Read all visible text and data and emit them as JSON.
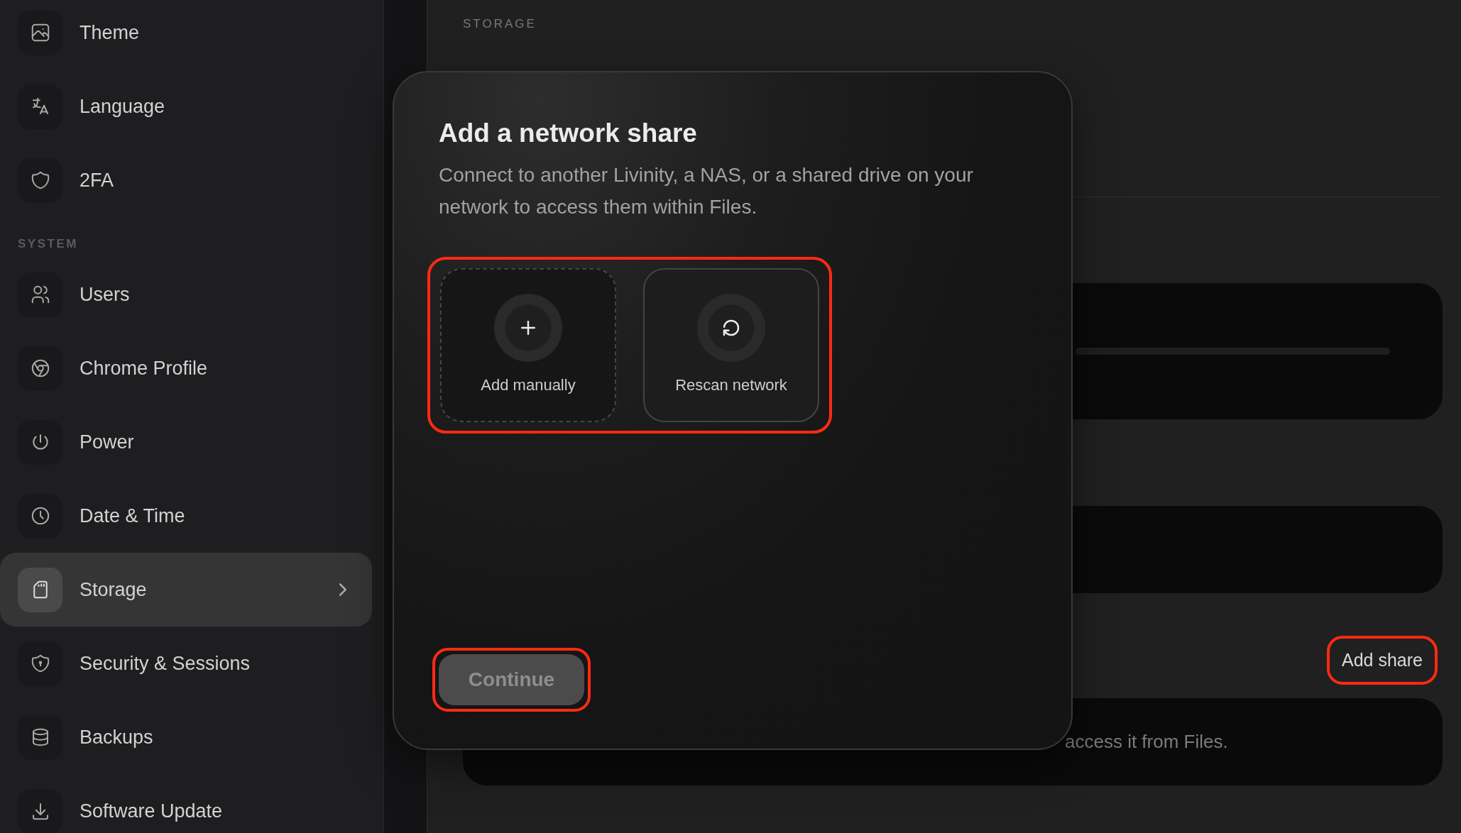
{
  "sidebar": {
    "sections": [
      {
        "items": [
          {
            "label": "Theme",
            "selected": false
          },
          {
            "label": "Language",
            "selected": false
          },
          {
            "label": "2FA",
            "selected": false
          }
        ]
      },
      {
        "title": "SYSTEM",
        "items": [
          {
            "label": "Users",
            "selected": false
          },
          {
            "label": "Chrome Profile",
            "selected": false
          },
          {
            "label": "Power",
            "selected": false
          },
          {
            "label": "Date & Time",
            "selected": false
          },
          {
            "label": "Storage",
            "selected": true
          },
          {
            "label": "Security & Sessions",
            "selected": false
          },
          {
            "label": "Backups",
            "selected": false
          },
          {
            "label": "Software Update",
            "selected": false
          }
        ]
      }
    ]
  },
  "page": {
    "section_label": "STORAGE",
    "add_share_button": {
      "label": "Add share",
      "highlighted": true
    },
    "shares_card": {
      "text": "access it from Files."
    }
  },
  "modal": {
    "title": "Add a network share",
    "description": "Connect to another Livinity, a NAS, or a shared drive on your network to access them within Files.",
    "options": {
      "highlighted": true,
      "items": [
        {
          "kind": "add",
          "label": "Add manually"
        },
        {
          "kind": "rescan",
          "label": "Rescan network"
        }
      ]
    },
    "continue_button": {
      "label": "Continue",
      "disabled": true,
      "highlighted": true
    }
  }
}
